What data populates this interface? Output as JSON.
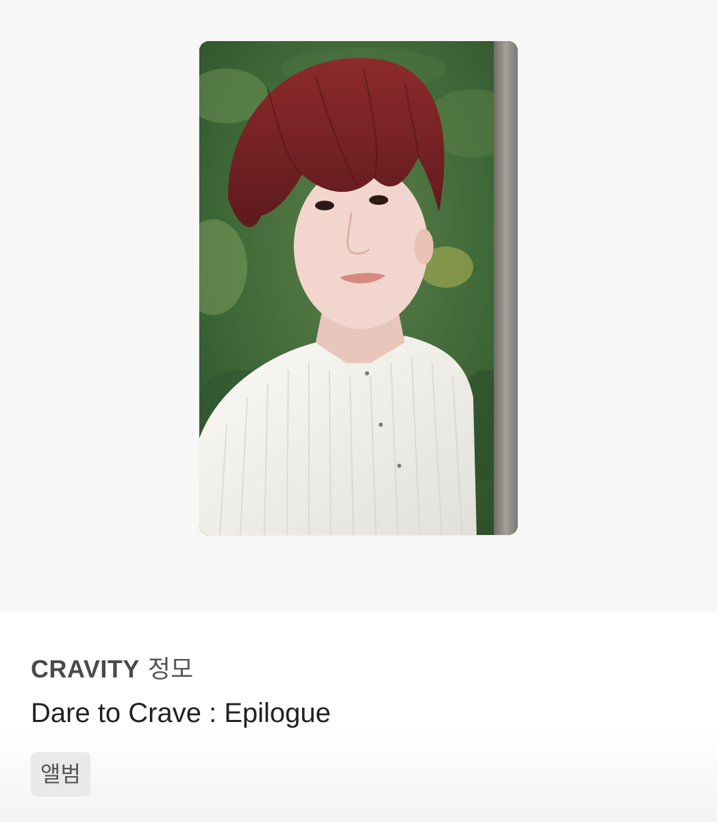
{
  "card": {
    "group": "CRAVITY",
    "member": "정모",
    "album": "Dare to Crave : Epilogue",
    "tag": "앨범"
  },
  "image": {
    "subject": "photocard-portrait",
    "colors": {
      "foliage": "#3f6b37",
      "hair": "#7a2326",
      "skin": "#f2d6cd",
      "shirt": "#f3f1ec",
      "tree": "#8a8a84"
    }
  }
}
